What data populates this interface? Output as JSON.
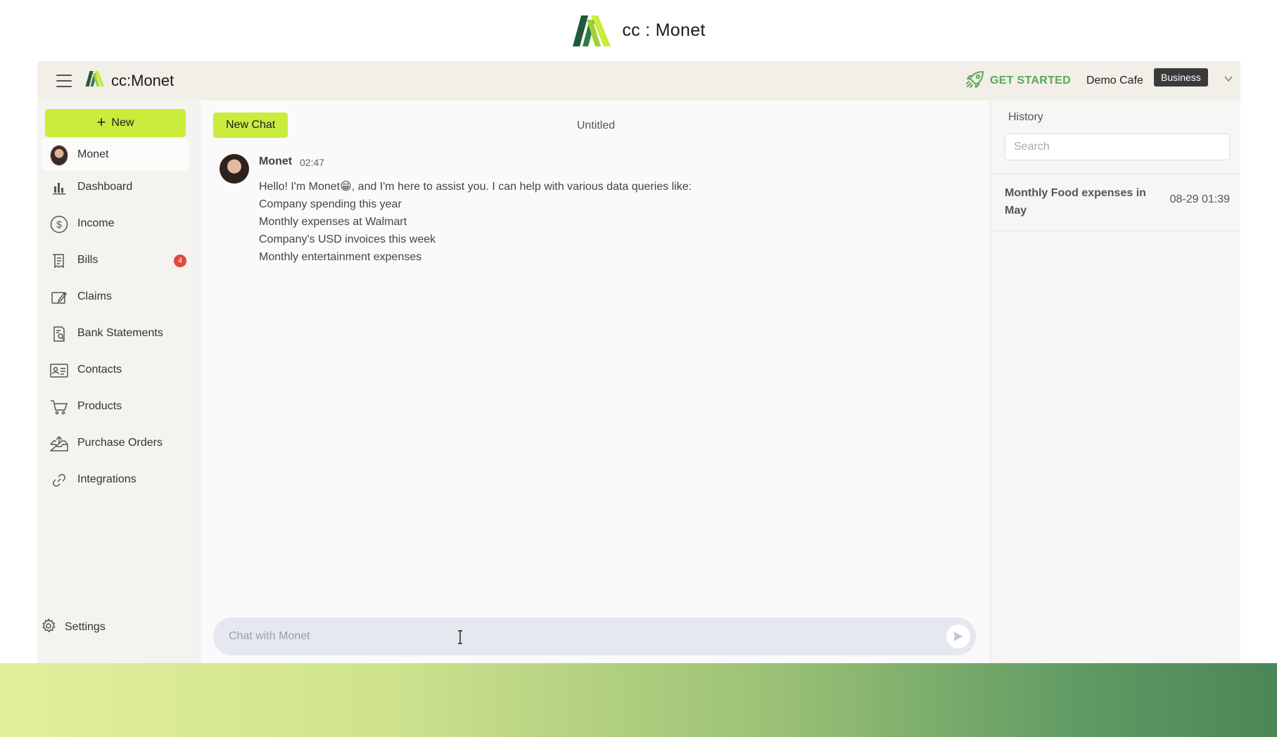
{
  "brand": {
    "name": "cc:Monet",
    "top_name": "cc : Monet"
  },
  "header": {
    "get_started": "GET STARTED",
    "org_name": "Demo Cafe",
    "plan_badge": "Business"
  },
  "sidebar": {
    "new_button": "New",
    "items": [
      {
        "label": "Monet",
        "icon": "avatar",
        "active": true
      },
      {
        "label": "Dashboard",
        "icon": "bar-chart-icon"
      },
      {
        "label": "Income",
        "icon": "dollar-circle-icon"
      },
      {
        "label": "Bills",
        "icon": "receipt-icon",
        "badge": "4"
      },
      {
        "label": "Claims",
        "icon": "claims-icon"
      },
      {
        "label": "Bank Statements",
        "icon": "statement-icon"
      },
      {
        "label": "Contacts",
        "icon": "contact-card-icon"
      },
      {
        "label": "Products",
        "icon": "cart-icon"
      },
      {
        "label": "Purchase Orders",
        "icon": "inbox-upload-icon"
      },
      {
        "label": "Integrations",
        "icon": "link-icon"
      }
    ],
    "settings": "Settings"
  },
  "chat": {
    "new_chat_button": "New Chat",
    "title": "Untitled",
    "message": {
      "author": "Monet",
      "time": "02:47",
      "lines": [
        "Hello! I'm Monet😁, and I'm here to assist you. I can help with various data queries like:",
        "Company spending this year",
        "Monthly expenses at Walmart",
        "Company's USD invoices this week",
        "Monthly entertainment expenses"
      ]
    },
    "input_placeholder": "Chat with Monet",
    "input_value": ""
  },
  "history": {
    "title": "History",
    "search_placeholder": "Search",
    "items": [
      {
        "name": "Monthly Food expenses in May",
        "date": "08-29 01:39"
      }
    ]
  },
  "colors": {
    "accent_lime": "#c9ec3d",
    "get_started_green": "#5aa85a",
    "badge_red": "#e5473f",
    "plan_badge_bg": "#3a3a3a"
  }
}
